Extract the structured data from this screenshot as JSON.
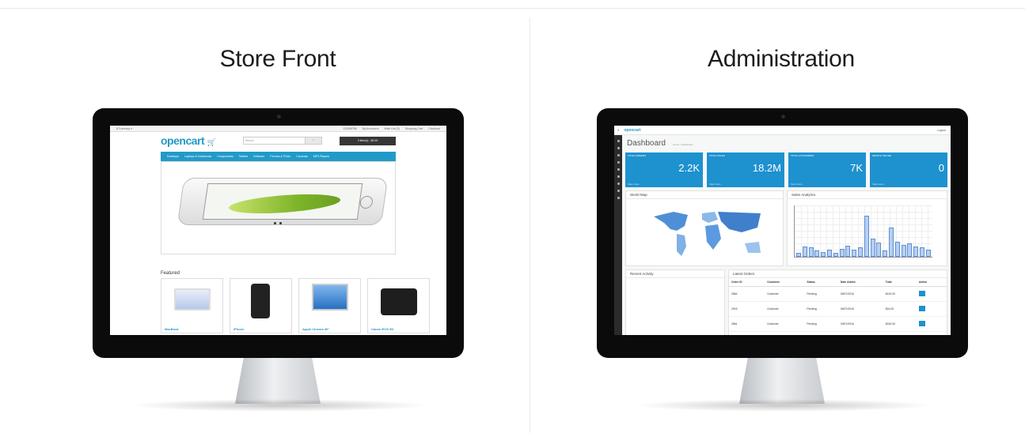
{
  "sections": {
    "store": {
      "title": "Store Front"
    },
    "admin": {
      "title": "Administration"
    }
  },
  "store_screen": {
    "topbar_left": "$ Currency ▾",
    "topbar_links": [
      "123456789",
      "My Account ▾",
      "Wish List (0)",
      "Shopping Cart",
      "Checkout"
    ],
    "logo": "opencart",
    "search_placeholder": "Search",
    "cart_button": "0 item(s) - $0.00",
    "nav": [
      "Desktops",
      "Laptops & Notebooks",
      "Components",
      "Tablets",
      "Software",
      "Phones & PDAs",
      "Cameras",
      "MP3 Players"
    ],
    "featured_heading": "Featured",
    "products": [
      "MacBook",
      "iPhone",
      "Apple Cinema 30\"",
      "Canon EOS 5D"
    ]
  },
  "admin_screen": {
    "logo": "opencart",
    "logout": "Logout",
    "title": "Dashboard",
    "breadcrumb": "Home › Dashboard",
    "tiles": [
      {
        "label": "TOTAL ORDERS",
        "value": "2.2K",
        "more": "View more..."
      },
      {
        "label": "TOTAL SALES",
        "value": "18.2M",
        "more": "View more..."
      },
      {
        "label": "TOTAL CUSTOMERS",
        "value": "7K",
        "more": "View more..."
      },
      {
        "label": "PEOPLE ONLINE",
        "value": "0",
        "more": "View more..."
      }
    ],
    "world_map_title": "World Map",
    "sales_title": "Sales Analytics",
    "activity_title": "Recent Activity",
    "orders_title": "Latest Orders",
    "orders_headers": [
      "Order ID",
      "Customer",
      "Status",
      "Date Added",
      "Total",
      "Action"
    ],
    "orders_rows": [
      [
        "2864",
        "Customer",
        "Pending",
        "05/07/2016",
        "$130.00"
      ],
      [
        "2915",
        "Customer",
        "Pending",
        "05/07/2016",
        "$16.00"
      ],
      [
        "2861",
        "Customer",
        "Pending",
        "03/07/2016",
        "$150.00"
      ]
    ],
    "sales_bars": [
      8,
      20,
      18,
      12,
      10,
      14,
      8,
      16,
      22,
      14,
      18,
      82,
      36,
      28,
      12,
      58,
      30,
      24,
      26,
      20,
      18,
      14
    ]
  }
}
